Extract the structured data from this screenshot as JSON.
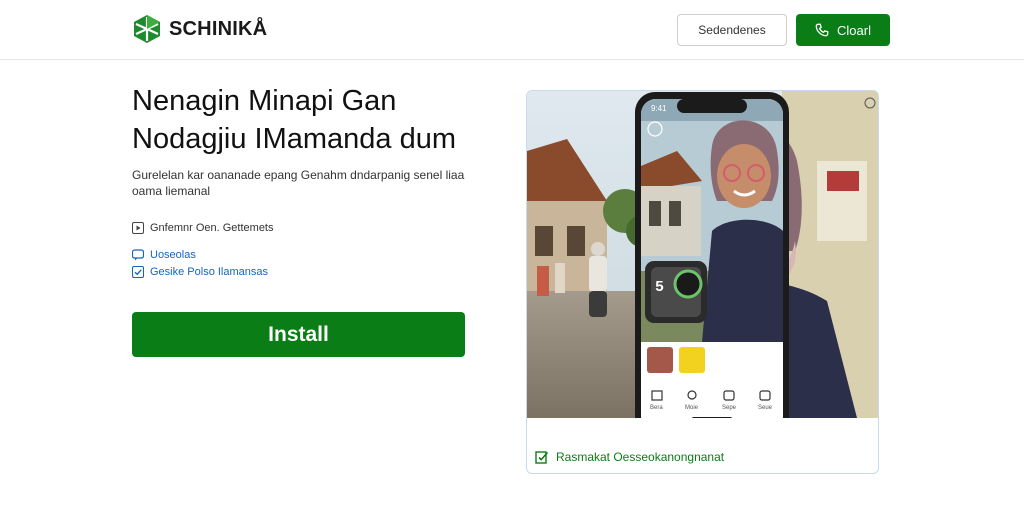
{
  "header": {
    "brand": "SCHINIKÅ",
    "secondary_button": "Sedendenes",
    "primary_button": "Cloarl",
    "phone_icon": "phone-icon"
  },
  "hero": {
    "headline_line1": "Nenagin Minapi Gan",
    "headline_line2": "Nodagjiu IMamanda dum",
    "subtext": "Gurelelan kar oananade epang Genahm dndarpanig senel liaa oama liemanal",
    "features": [
      {
        "label": "Gnfemnr Oen. Gettemets",
        "icon": "play-icon"
      },
      {
        "label": "Uoseolas",
        "icon": "chat-icon"
      },
      {
        "label": "Gesike Polso Ilamansas",
        "icon": "check-icon"
      }
    ],
    "install_label": "Install"
  },
  "preview": {
    "footer_text": "Rasmakat Oesseokanongnanat",
    "phone_status_time": "9:41",
    "nav_items": [
      "Bera",
      "Moie",
      "Sepe",
      "Seue"
    ]
  },
  "colors": {
    "brand_green": "#0b7d16",
    "link_blue": "#1565c0",
    "card_border": "#c9dbe8"
  }
}
